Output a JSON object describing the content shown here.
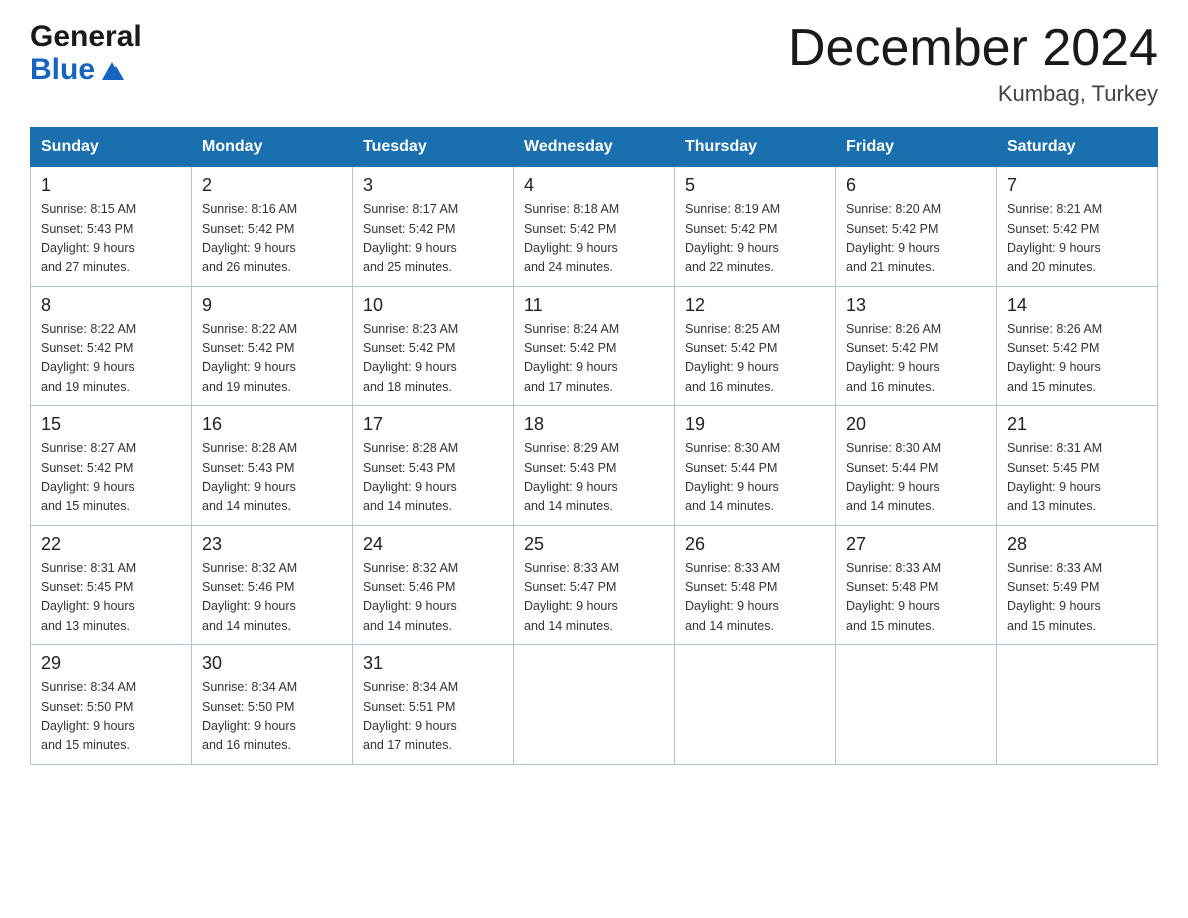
{
  "header": {
    "logo_general": "General",
    "logo_blue": "Blue",
    "month_title": "December 2024",
    "location": "Kumbag, Turkey"
  },
  "weekdays": [
    "Sunday",
    "Monday",
    "Tuesday",
    "Wednesday",
    "Thursday",
    "Friday",
    "Saturday"
  ],
  "weeks": [
    [
      {
        "day": "1",
        "sunrise": "8:15 AM",
        "sunset": "5:43 PM",
        "daylight": "9 hours and 27 minutes."
      },
      {
        "day": "2",
        "sunrise": "8:16 AM",
        "sunset": "5:42 PM",
        "daylight": "9 hours and 26 minutes."
      },
      {
        "day": "3",
        "sunrise": "8:17 AM",
        "sunset": "5:42 PM",
        "daylight": "9 hours and 25 minutes."
      },
      {
        "day": "4",
        "sunrise": "8:18 AM",
        "sunset": "5:42 PM",
        "daylight": "9 hours and 24 minutes."
      },
      {
        "day": "5",
        "sunrise": "8:19 AM",
        "sunset": "5:42 PM",
        "daylight": "9 hours and 22 minutes."
      },
      {
        "day": "6",
        "sunrise": "8:20 AM",
        "sunset": "5:42 PM",
        "daylight": "9 hours and 21 minutes."
      },
      {
        "day": "7",
        "sunrise": "8:21 AM",
        "sunset": "5:42 PM",
        "daylight": "9 hours and 20 minutes."
      }
    ],
    [
      {
        "day": "8",
        "sunrise": "8:22 AM",
        "sunset": "5:42 PM",
        "daylight": "9 hours and 19 minutes."
      },
      {
        "day": "9",
        "sunrise": "8:22 AM",
        "sunset": "5:42 PM",
        "daylight": "9 hours and 19 minutes."
      },
      {
        "day": "10",
        "sunrise": "8:23 AM",
        "sunset": "5:42 PM",
        "daylight": "9 hours and 18 minutes."
      },
      {
        "day": "11",
        "sunrise": "8:24 AM",
        "sunset": "5:42 PM",
        "daylight": "9 hours and 17 minutes."
      },
      {
        "day": "12",
        "sunrise": "8:25 AM",
        "sunset": "5:42 PM",
        "daylight": "9 hours and 16 minutes."
      },
      {
        "day": "13",
        "sunrise": "8:26 AM",
        "sunset": "5:42 PM",
        "daylight": "9 hours and 16 minutes."
      },
      {
        "day": "14",
        "sunrise": "8:26 AM",
        "sunset": "5:42 PM",
        "daylight": "9 hours and 15 minutes."
      }
    ],
    [
      {
        "day": "15",
        "sunrise": "8:27 AM",
        "sunset": "5:42 PM",
        "daylight": "9 hours and 15 minutes."
      },
      {
        "day": "16",
        "sunrise": "8:28 AM",
        "sunset": "5:43 PM",
        "daylight": "9 hours and 14 minutes."
      },
      {
        "day": "17",
        "sunrise": "8:28 AM",
        "sunset": "5:43 PM",
        "daylight": "9 hours and 14 minutes."
      },
      {
        "day": "18",
        "sunrise": "8:29 AM",
        "sunset": "5:43 PM",
        "daylight": "9 hours and 14 minutes."
      },
      {
        "day": "19",
        "sunrise": "8:30 AM",
        "sunset": "5:44 PM",
        "daylight": "9 hours and 14 minutes."
      },
      {
        "day": "20",
        "sunrise": "8:30 AM",
        "sunset": "5:44 PM",
        "daylight": "9 hours and 14 minutes."
      },
      {
        "day": "21",
        "sunrise": "8:31 AM",
        "sunset": "5:45 PM",
        "daylight": "9 hours and 13 minutes."
      }
    ],
    [
      {
        "day": "22",
        "sunrise": "8:31 AM",
        "sunset": "5:45 PM",
        "daylight": "9 hours and 13 minutes."
      },
      {
        "day": "23",
        "sunrise": "8:32 AM",
        "sunset": "5:46 PM",
        "daylight": "9 hours and 14 minutes."
      },
      {
        "day": "24",
        "sunrise": "8:32 AM",
        "sunset": "5:46 PM",
        "daylight": "9 hours and 14 minutes."
      },
      {
        "day": "25",
        "sunrise": "8:33 AM",
        "sunset": "5:47 PM",
        "daylight": "9 hours and 14 minutes."
      },
      {
        "day": "26",
        "sunrise": "8:33 AM",
        "sunset": "5:48 PM",
        "daylight": "9 hours and 14 minutes."
      },
      {
        "day": "27",
        "sunrise": "8:33 AM",
        "sunset": "5:48 PM",
        "daylight": "9 hours and 15 minutes."
      },
      {
        "day": "28",
        "sunrise": "8:33 AM",
        "sunset": "5:49 PM",
        "daylight": "9 hours and 15 minutes."
      }
    ],
    [
      {
        "day": "29",
        "sunrise": "8:34 AM",
        "sunset": "5:50 PM",
        "daylight": "9 hours and 15 minutes."
      },
      {
        "day": "30",
        "sunrise": "8:34 AM",
        "sunset": "5:50 PM",
        "daylight": "9 hours and 16 minutes."
      },
      {
        "day": "31",
        "sunrise": "8:34 AM",
        "sunset": "5:51 PM",
        "daylight": "9 hours and 17 minutes."
      },
      null,
      null,
      null,
      null
    ]
  ],
  "labels": {
    "sunrise": "Sunrise:",
    "sunset": "Sunset:",
    "daylight": "Daylight:"
  }
}
